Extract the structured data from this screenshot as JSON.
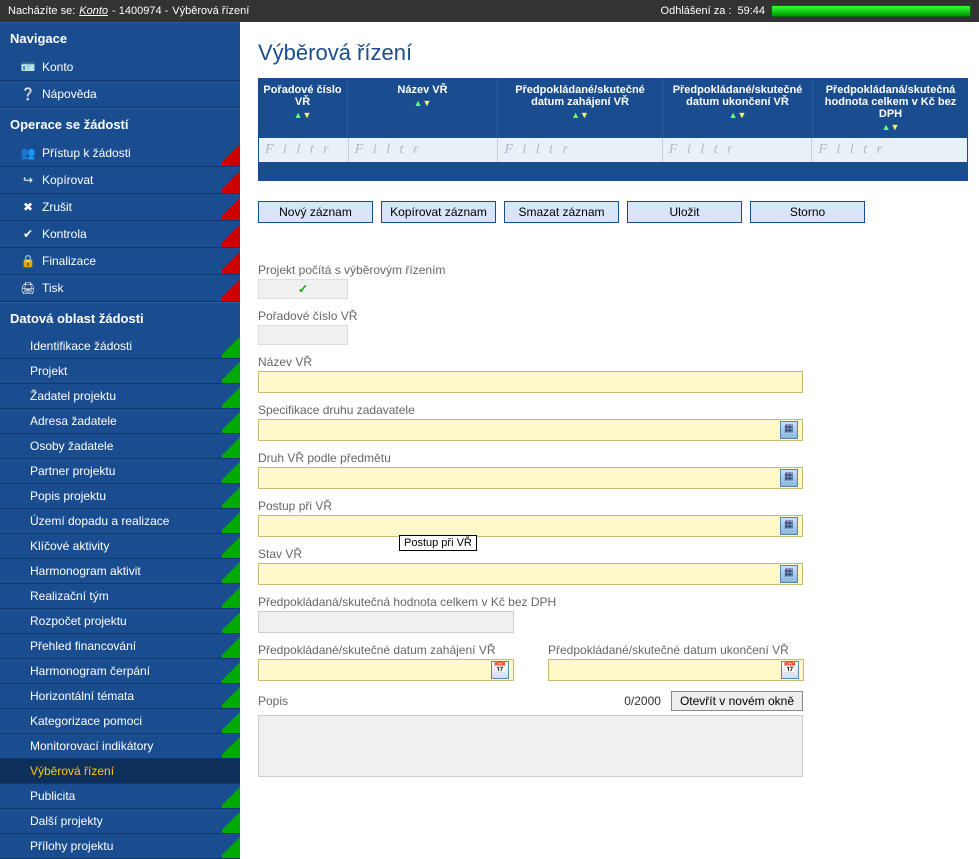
{
  "topbar": {
    "location_prefix": "Nacházíte se:",
    "konto": "Konto",
    "id": "- 1400974 -",
    "page": "Výběrová řízení",
    "logout_label": "Odhlášení za :",
    "logout_time": "59:44"
  },
  "sidebar": {
    "nav_title": "Navigace",
    "nav_items": [
      {
        "label": "Konto",
        "icon": "🪪"
      },
      {
        "label": "Nápověda",
        "icon": "❔"
      }
    ],
    "ops_title": "Operace se žádostí",
    "ops_items": [
      {
        "label": "Přístup k žádosti",
        "icon": "👥",
        "mark": "red"
      },
      {
        "label": "Kopírovat",
        "icon": "↪",
        "mark": "red"
      },
      {
        "label": "Zrušit",
        "icon": "✖",
        "mark": "red"
      },
      {
        "label": "Kontrola",
        "icon": "✔",
        "mark": "red"
      },
      {
        "label": "Finalizace",
        "icon": "🔒",
        "mark": "red"
      },
      {
        "label": "Tisk",
        "icon": "🖨",
        "mark": "red"
      }
    ],
    "data_title": "Datová oblast žádosti",
    "data_items": [
      {
        "label": "Identifikace žádosti",
        "mark": "green"
      },
      {
        "label": "Projekt",
        "mark": "green"
      },
      {
        "label": "Žadatel projektu",
        "mark": "green"
      },
      {
        "label": "Adresa žadatele",
        "mark": "green"
      },
      {
        "label": "Osoby žadatele",
        "mark": "green"
      },
      {
        "label": "Partner projektu",
        "mark": "green"
      },
      {
        "label": "Popis projektu",
        "mark": "green"
      },
      {
        "label": "Území dopadu a realizace",
        "mark": "green"
      },
      {
        "label": "Klíčové aktivity",
        "mark": "green"
      },
      {
        "label": "Harmonogram aktivit",
        "mark": "green"
      },
      {
        "label": "Realizační tým",
        "mark": "green"
      },
      {
        "label": "Rozpočet projektu",
        "mark": "green"
      },
      {
        "label": "Přehled financování",
        "mark": "green"
      },
      {
        "label": "Harmonogram čerpání",
        "mark": "green"
      },
      {
        "label": "Horizontální témata",
        "mark": "green"
      },
      {
        "label": "Kategorizace pomoci",
        "mark": "green"
      },
      {
        "label": "Monitorovací indikátory",
        "mark": "green"
      },
      {
        "label": "Výběrová řízení",
        "mark": "",
        "active": true
      },
      {
        "label": "Publicita",
        "mark": "green"
      },
      {
        "label": "Další projekty",
        "mark": "green"
      },
      {
        "label": "Přílohy projektu",
        "mark": "green"
      }
    ]
  },
  "main": {
    "title": "Výběrová řízení",
    "grid_cols": [
      "Pořadové číslo VŘ",
      "Název VŘ",
      "Předpokládané/skutečné datum zahájení VŘ",
      "Předpokládané/skutečné datum ukončení VŘ",
      "Předpokládaná/skutečná hodnota celkem v Kč bez DPH"
    ],
    "filter_placeholder": "F i l t r",
    "actions": {
      "new": "Nový záznam",
      "copy": "Kopírovat záznam",
      "delete": "Smazat záznam",
      "save": "Uložit",
      "cancel": "Storno"
    },
    "form": {
      "proj_check_label": "Projekt počítá s výběrovým řízením",
      "proj_check_value": "✓",
      "poradove_label": "Pořadové číslo VŘ",
      "nazev_label": "Název VŘ",
      "spec_label": "Specifikace druhu zadavatele",
      "druh_label": "Druh VŘ podle předmětu",
      "postup_label": "Postup při VŘ",
      "postup_tooltip": "Postup při VŘ",
      "stav_label": "Stav VŘ",
      "hodnota_label": "Předpokládaná/skutečná hodnota celkem v Kč bez DPH",
      "datum_zah_label": "Předpokládané/skutečné datum zahájení VŘ",
      "datum_ukon_label": "Předpokládané/skutečné datum ukončení VŘ",
      "popis_label": "Popis",
      "popis_count": "0/2000",
      "popis_open": "Otevřít v novém okně"
    }
  }
}
